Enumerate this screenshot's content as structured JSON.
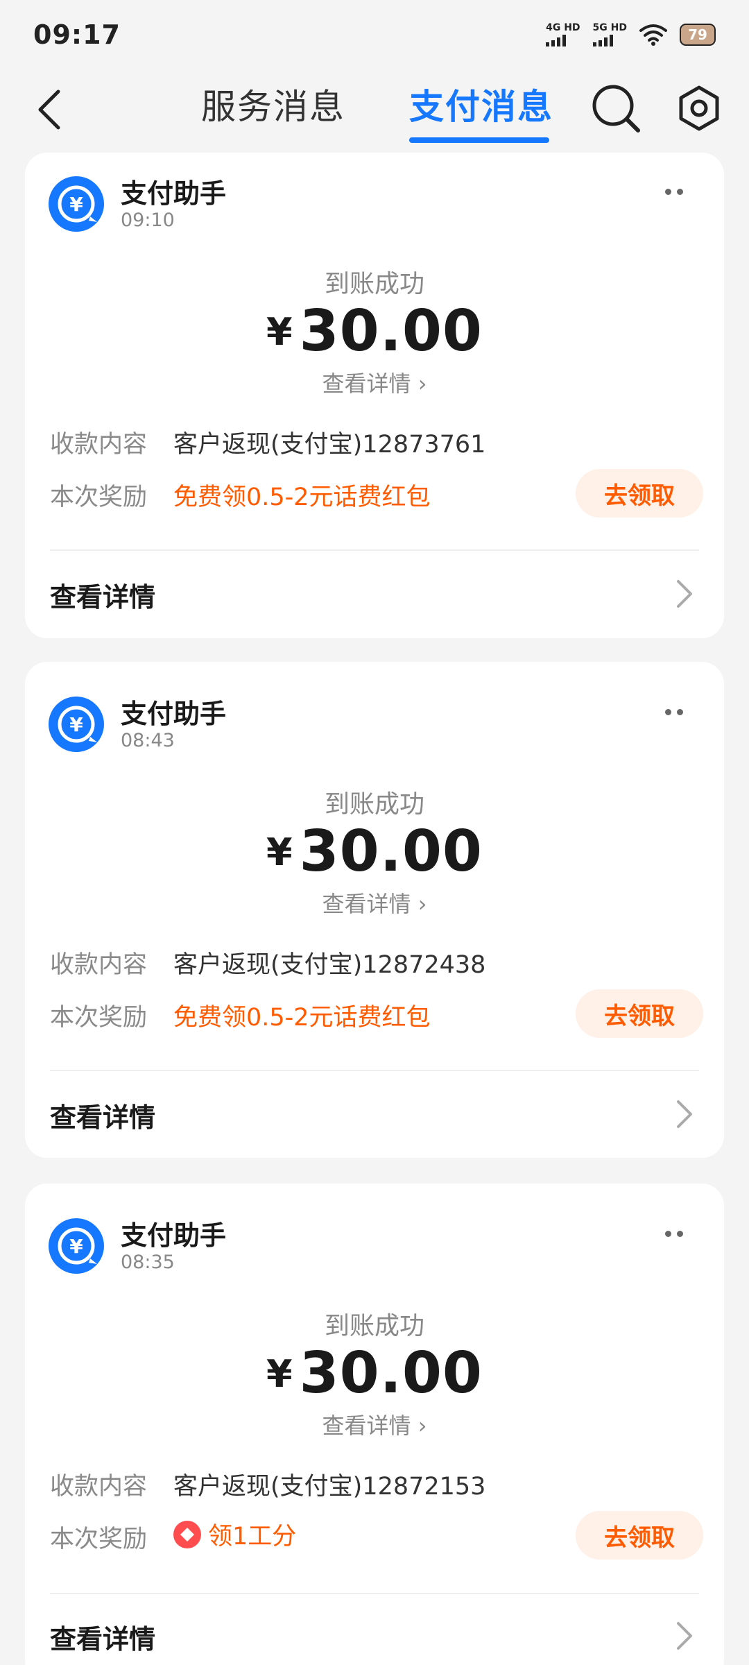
{
  "status_bar": {
    "time": "09:17",
    "net1": "4G HD",
    "net2": "5G HD",
    "battery": "79",
    "icons": [
      "signal-icon",
      "wifi-icon",
      "battery-icon"
    ]
  },
  "header": {
    "tabs": [
      {
        "label": "服务消息",
        "active": false
      },
      {
        "label": "支付消息",
        "active": true
      }
    ],
    "accent_color": "#1677ff",
    "icons": [
      "back-icon",
      "search-icon",
      "gear-icon"
    ]
  },
  "cards": [
    {
      "sender": "支付助手",
      "time": "09:10",
      "status": "到账成功",
      "currency": "¥",
      "amount": "30.00",
      "detail_link": "查看详情",
      "content_label": "收款内容",
      "content_value": "客户返现(支付宝)12873761",
      "reward_label": "本次奖励",
      "reward_value": "免费领0.5-2元话费红包",
      "claim_label": "去领取",
      "footer_link": "查看详情"
    },
    {
      "sender": "支付助手",
      "time": "08:43",
      "status": "到账成功",
      "currency": "¥",
      "amount": "30.00",
      "detail_link": "查看详情",
      "content_label": "收款内容",
      "content_value": "客户返现(支付宝)12872438",
      "reward_label": "本次奖励",
      "reward_value": "免费领0.5-2元话费红包",
      "claim_label": "去领取",
      "footer_link": "查看详情"
    },
    {
      "sender": "支付助手",
      "time": "08:35",
      "status": "到账成功",
      "currency": "¥",
      "amount": "30.00",
      "detail_link": "查看详情",
      "content_label": "收款内容",
      "content_value": "客户返现(支付宝)12872153",
      "reward_label": "本次奖励",
      "reward_value": "领1工分",
      "claim_label": "去领取",
      "footer_link": "查看详情"
    }
  ],
  "colors": {
    "accent": "#1677ff",
    "reward": "#ff5b00",
    "claim_bg": "#fff0e8"
  }
}
